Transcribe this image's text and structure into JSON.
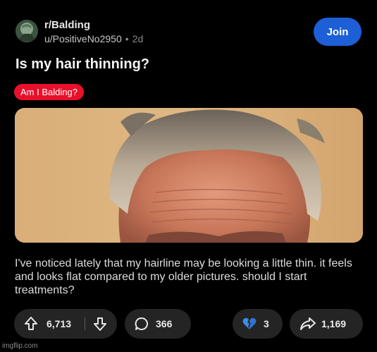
{
  "post": {
    "subreddit": "r/Balding",
    "author": "u/PositiveNo2950",
    "separator": "•",
    "age": "2d",
    "join_label": "Join",
    "title": "Is my hair thinning?",
    "flair": "Am I Balding?",
    "body": "I've noticed lately that my hairline may be looking a little thin. it feels and looks flat compared to my older pictures. should I start treatments?"
  },
  "actions": {
    "upvotes": "6,713",
    "comments": "366",
    "awards": "3",
    "shares": "1,169"
  },
  "icons": {
    "upvote": "upvote-arrow-icon",
    "downvote": "downvote-arrow-icon",
    "comment": "comment-bubble-icon",
    "award": "broken-heart-icon",
    "share": "share-arrow-icon"
  },
  "colors": {
    "background": "#000000",
    "join_button": "#1c5fd6",
    "flair": "#e8102a",
    "pill": "#242424",
    "award_heart": "#3d8be8"
  },
  "watermark": "imgflip.com"
}
